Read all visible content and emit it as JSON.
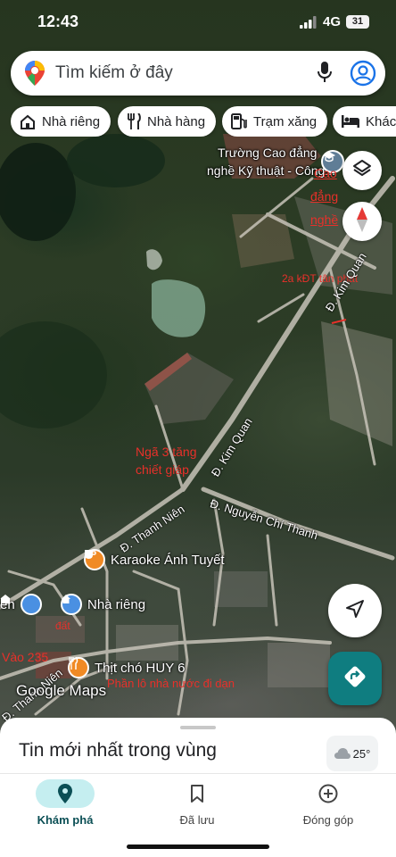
{
  "status_bar": {
    "time": "12:43",
    "network": "4G",
    "battery": "31"
  },
  "search": {
    "placeholder": "Tìm kiếm ở đây"
  },
  "chips": [
    {
      "label": "Nhà riêng",
      "icon": "home-icon"
    },
    {
      "label": "Nhà hàng",
      "icon": "restaurant-icon"
    },
    {
      "label": "Trạm xăng",
      "icon": "gas-station-icon"
    },
    {
      "label": "Khách",
      "icon": "hotel-icon"
    }
  ],
  "map": {
    "places": {
      "college_line1": "Trường Cao đẳng",
      "college_line2": "nghề Kỹ thuật - Công..."
    },
    "roads": {
      "kim_quan_north": "Đ. Kim Quan",
      "kim_quan_south": "Đ. Kim Quan",
      "thanh_nien": "Đ. Thanh Niên",
      "nguyen_chi_thanh": "Đ. Nguyễn Chí Thanh",
      "thanh_nien_sw": "Đ. Thanh Niên"
    },
    "annotations": {
      "cao_dang_nghe_1": "Cao",
      "cao_dang_nghe_2": "đẳng",
      "cao_dang_nghe_3": "nghề",
      "khu_do_thi": "2a kĐT tân phat",
      "nga3_line1": "Ngã 3 tăng",
      "nga3_line2": "chiết giáp",
      "vao": "Vào 235",
      "dat": "đất",
      "phan": "Phần lô nhà nước đi dạn"
    },
    "pois": {
      "karaoke": "Karaoke Ánh Tuyết",
      "nha_rieng": "Nhà riêng",
      "left_partial": "ền",
      "thit_cho": "Thịt chó HUY 6"
    },
    "watermark": "Google Maps"
  },
  "colors": {
    "accent": "#0f7d80",
    "annotation_red": "#e8302a",
    "poi_orange": "#f08a24",
    "poi_blue": "#4a90e2"
  },
  "sheet": {
    "title": "Tin mới nhất trong vùng",
    "temperature": "25°"
  },
  "bottom_nav": [
    {
      "label": "Khám phá",
      "icon": "explore-pin-icon",
      "active": true
    },
    {
      "label": "Đã lưu",
      "icon": "bookmark-icon",
      "active": false
    },
    {
      "label": "Đóng góp",
      "icon": "add-circle-icon",
      "active": false
    }
  ]
}
